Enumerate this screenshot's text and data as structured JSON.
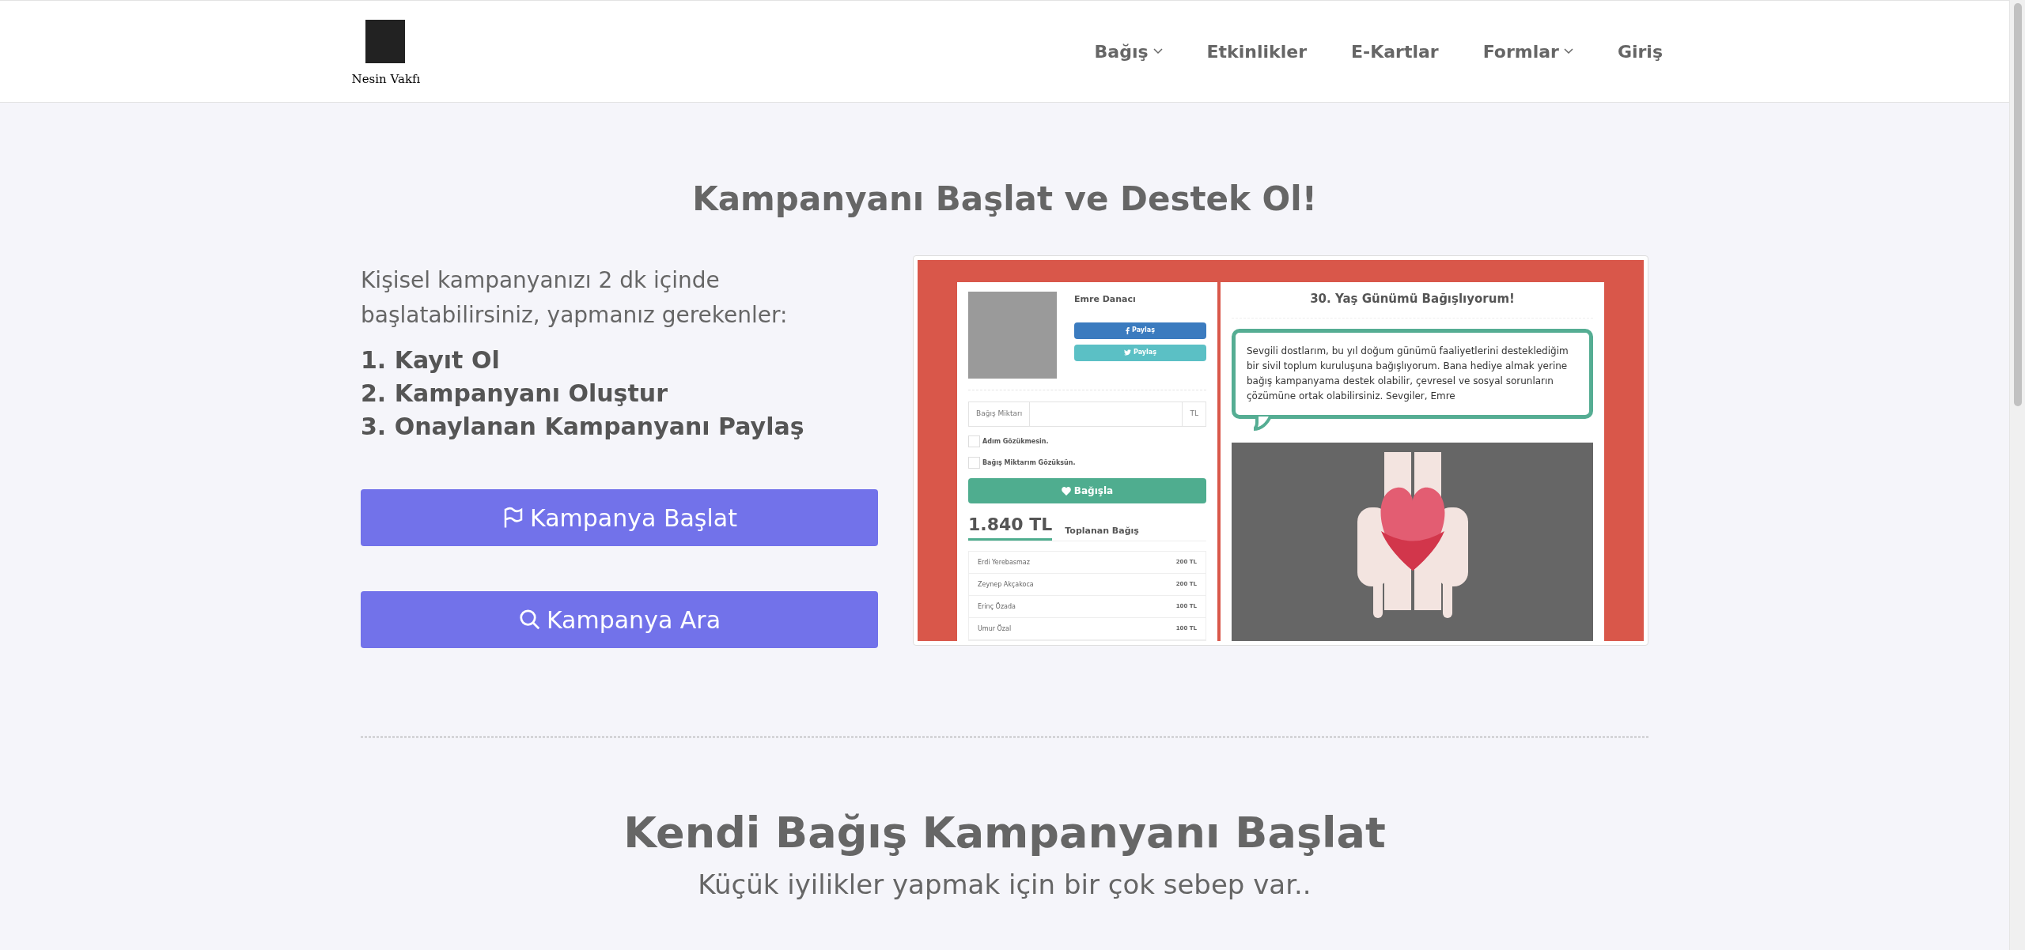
{
  "header": {
    "logo_text": "Nesin Vakfı",
    "nav": [
      {
        "label": "Bağış",
        "dropdown": true
      },
      {
        "label": "Etkinlikler",
        "dropdown": false
      },
      {
        "label": "E-Kartlar",
        "dropdown": false
      },
      {
        "label": "Formlar",
        "dropdown": true
      },
      {
        "label": "Giriş",
        "dropdown": false
      }
    ]
  },
  "hero": {
    "title": "Kampanyanı Başlat ve Destek Ol!",
    "intro": "Kişisel kampanyanızı 2 dk içinde başlatabilirsiniz, yapmanız gerekenler:",
    "steps": [
      "1. Kayıt Ol",
      "2. Kampanyanı Oluştur",
      "3. Onaylanan Kampanyanı Paylaş"
    ],
    "buttons": [
      {
        "kind": "flag",
        "label": "Kampanya Başlat"
      },
      {
        "kind": "search",
        "label": "Kampanya Ara"
      }
    ]
  },
  "preview": {
    "name": "Emre Danacı",
    "share_buttons": [
      {
        "kind": "facebook",
        "label": "Paylaş"
      },
      {
        "kind": "twitter",
        "label": "Paylaş"
      }
    ],
    "amount_label": "Bağış Miktarı",
    "currency": "TL",
    "options": [
      {
        "label": "Adım Gözükmesin.",
        "checked": false
      },
      {
        "label": "Bağış Miktarım Gözüksün.",
        "checked": false
      }
    ],
    "donate_button": "Bağışla",
    "total": "1.840 TL",
    "total_label": "Toplanan Bağış",
    "donors": [
      {
        "name": "Erdi Yerebasmaz",
        "amount": "200 TL"
      },
      {
        "name": "Zeynep Akçakoca",
        "amount": "200 TL"
      },
      {
        "name": "Erinç Özada",
        "amount": "100 TL"
      },
      {
        "name": "Umur Özal",
        "amount": "100 TL"
      }
    ],
    "campaign_title": "30. Yaş Günümü Bağışlıyorum!",
    "message": "Sevgili dostlarım, bu yıl doğum günümü faaliyetlerini desteklediğim bir sivil toplum kuruluşuna bağışlıyorum. Bana hediye almak yerine bağış kampanyama destek olabilir, çevresel ve sosyal sorunların çözümüne ortak olabilirsiniz. Sevgiler, Emre"
  },
  "section": {
    "title": "Kendi Bağış Kampanyanı Başlat",
    "subtitle": "Küçük iyilikler yapmak için bir çok sebep var.."
  }
}
